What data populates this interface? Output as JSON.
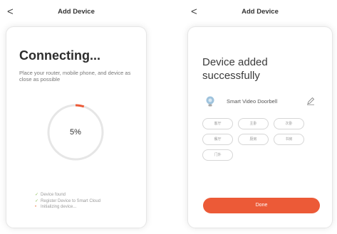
{
  "left": {
    "back_glyph": "<",
    "title": "Add Device",
    "heading": "Connecting...",
    "description": "Place your router, mobile phone, and device as close as possible",
    "progress_percent": 5,
    "progress_label": "5%",
    "steps": [
      {
        "mark": "✓",
        "label": "Device found",
        "done": true
      },
      {
        "mark": "✓",
        "label": "Register Device to Smart Cloud",
        "done": true
      },
      {
        "mark": "•",
        "label": "Initializing device...",
        "done": false
      }
    ]
  },
  "right": {
    "back_glyph": "<",
    "title": "Add Device",
    "heading_line1": "Device added",
    "heading_line2": "successfully",
    "device_name": "Smart Video Doorbell",
    "device_icon": "bulb-icon",
    "edit_icon": "pencil-icon",
    "rooms": [
      "客厅",
      "主卧",
      "次卧",
      "餐厅",
      "厨房",
      "书房",
      "门外"
    ],
    "done_label": "Done"
  },
  "colors": {
    "accent": "#ec5a37",
    "ring": "#e6e6e6",
    "check": "#8dbf5a",
    "device_icon": "#9fc3dd"
  }
}
